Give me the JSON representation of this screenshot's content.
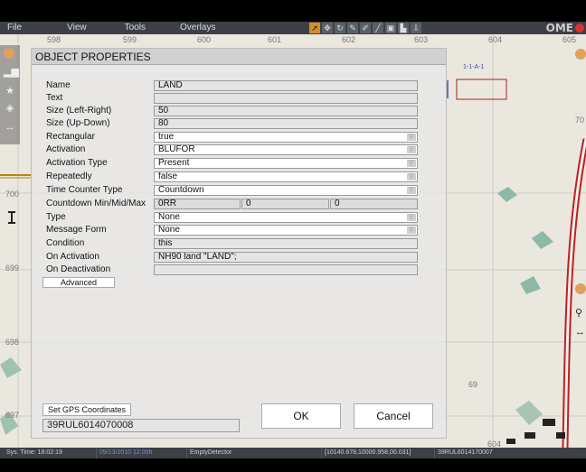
{
  "menu": {
    "file": "File",
    "view": "View",
    "tools": "Tools",
    "overlays": "Overlays"
  },
  "logo": "OME",
  "grid": {
    "top": [
      "598",
      "599",
      "600",
      "601",
      "602",
      "603",
      "604",
      "605"
    ],
    "left": [
      "700",
      "699",
      "698",
      "697"
    ],
    "bottom_right": "604",
    "marker": "1-1-A-1",
    "right_edge": "70",
    "map_69": "69"
  },
  "dialog": {
    "title": "OBJECT PROPERTIES",
    "rows": [
      {
        "label": "Name",
        "value": "LAND"
      },
      {
        "label": "Text",
        "value": ""
      },
      {
        "label": "Size (Left-Right)",
        "value": "50"
      },
      {
        "label": "Size (Up-Down)",
        "value": "80"
      },
      {
        "label": "Rectangular",
        "value": "true"
      },
      {
        "label": "Activation",
        "value": "BLUFOR"
      },
      {
        "label": "Activation Type",
        "value": "Present"
      },
      {
        "label": "Repeatedly",
        "value": "false"
      },
      {
        "label": "Time Counter Type",
        "value": "Countdown"
      },
      {
        "label": "Countdown Min/Mid/Max",
        "value": "0RR",
        "mid": "0",
        "max": "0"
      },
      {
        "label": "Type",
        "value": "None"
      },
      {
        "label": "Message Form",
        "value": "None"
      },
      {
        "label": "Condition",
        "value": "this"
      },
      {
        "label": "On Activation",
        "value": "NH90 land \"LAND\";"
      },
      {
        "label": "On Deactivation",
        "value": ""
      }
    ],
    "advanced_label": "Advanced",
    "gps_button": "Set GPS Coordinates",
    "gps_value": "39RUL6014070008",
    "ok_label": "OK",
    "cancel_label": "Cancel"
  },
  "status": {
    "sys_time": "Sys. Time: 18:02:19",
    "date": "09/13/2010 12:00h",
    "detector": "EmptyDetector",
    "coords": "[10140.678,10000.958,00.031]",
    "grid": "39RUL6014170007"
  }
}
